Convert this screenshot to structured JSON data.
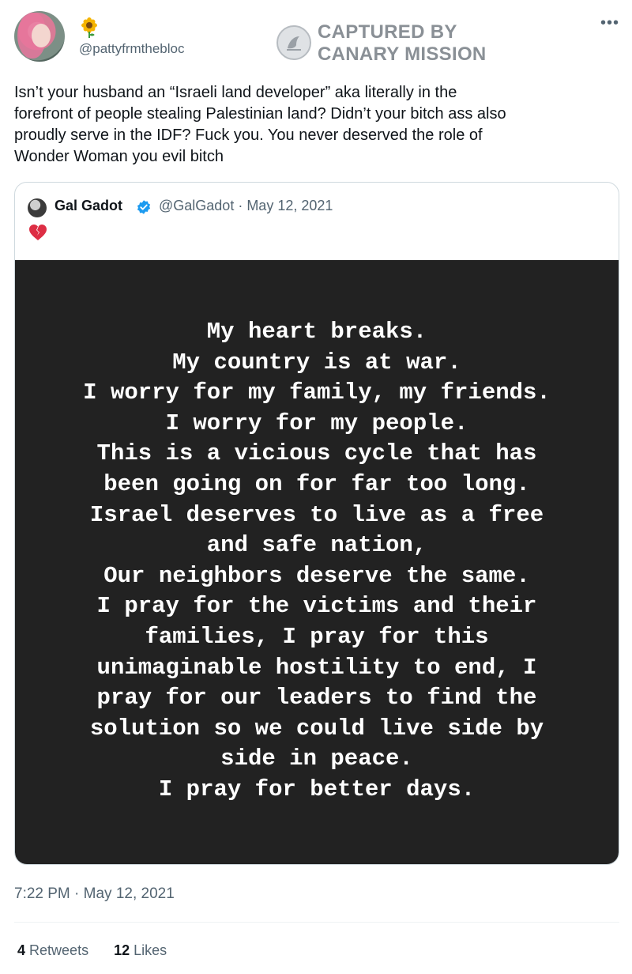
{
  "author": {
    "handle": "@pattyfrmthebloc",
    "emoji_icon": "sunflower-icon"
  },
  "watermark": {
    "line1": "CAPTURED BY",
    "line2": "CANARY MISSION"
  },
  "menu_icon": "more-options-icon",
  "tweet": {
    "text": "Isn’t your husband an “Israeli land developer” aka literally in the\nforefront of people stealing Palestinian land? Didn’t your bitch ass also\nproudly serve in the IDF? Fuck you. You never deserved the role of\nWonder Woman you evil bitch",
    "timestamp": "7:22 PM · May 12, 2021"
  },
  "quoted_tweet": {
    "name": "Gal Gadot",
    "meta": "@GalGadot · May 12, 2021",
    "emoji": "broken-heart-icon",
    "verified_color": "#1d9bf0",
    "image_text": [
      "My heart breaks.",
      "My country is at war.",
      "I worry for my family, my friends.",
      "I worry for my people.",
      "This is a vicious cycle that has",
      "been going on for far too long.",
      "Israel deserves to live as a free",
      "and safe nation,",
      "Our neighbors deserve the same.",
      "I pray for the victims and their",
      "families, I pray for this",
      "unimaginable hostility to end, I",
      "pray for our leaders to find the",
      "solution so we could live side by",
      "side in peace.",
      "I pray for better days."
    ]
  },
  "stats": {
    "retweets_count": "4",
    "retweets_label": "Retweets",
    "likes_count": "12",
    "likes_label": "Likes"
  }
}
